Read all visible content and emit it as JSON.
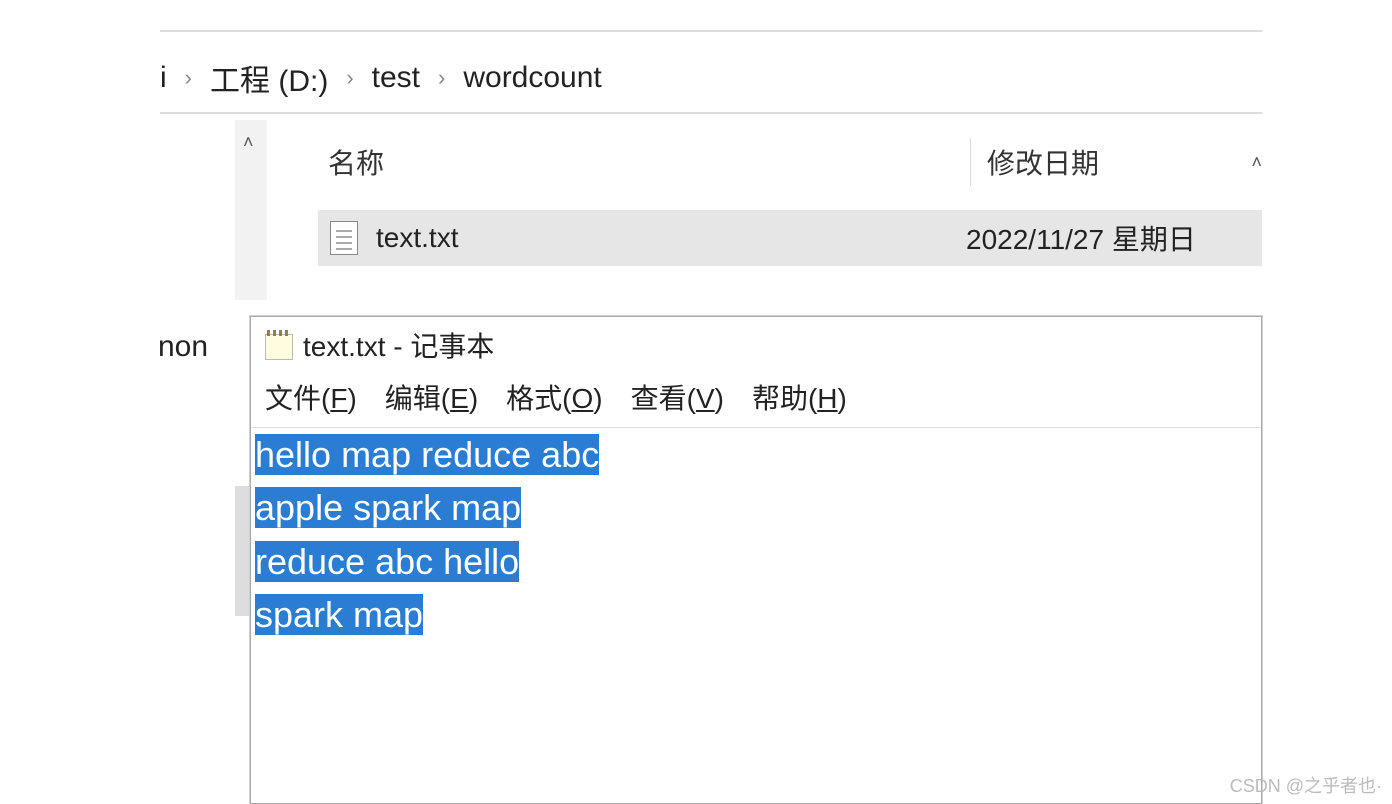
{
  "breadcrumb": {
    "part0": "i",
    "part1": "工程 (D:)",
    "part2": "test",
    "part3": "wordcount"
  },
  "explorer": {
    "header_name": "名称",
    "header_date": "修改日期",
    "file_name": "text.txt",
    "file_date": "2022/11/27 星期日"
  },
  "sidebar": {
    "fragment": "non"
  },
  "notepad": {
    "title": "text.txt - 记事本",
    "menu": {
      "file": {
        "label": "文件",
        "hotkey": "F"
      },
      "edit": {
        "label": "编辑",
        "hotkey": "E"
      },
      "format": {
        "label": "格式",
        "hotkey": "O"
      },
      "view": {
        "label": "查看",
        "hotkey": "V"
      },
      "help": {
        "label": "帮助",
        "hotkey": "H"
      }
    },
    "lines": [
      "hello map reduce abc",
      "apple spark map",
      "",
      "reduce abc hello",
      "",
      "spark map"
    ]
  },
  "watermark": "CSDN @之乎者也·"
}
